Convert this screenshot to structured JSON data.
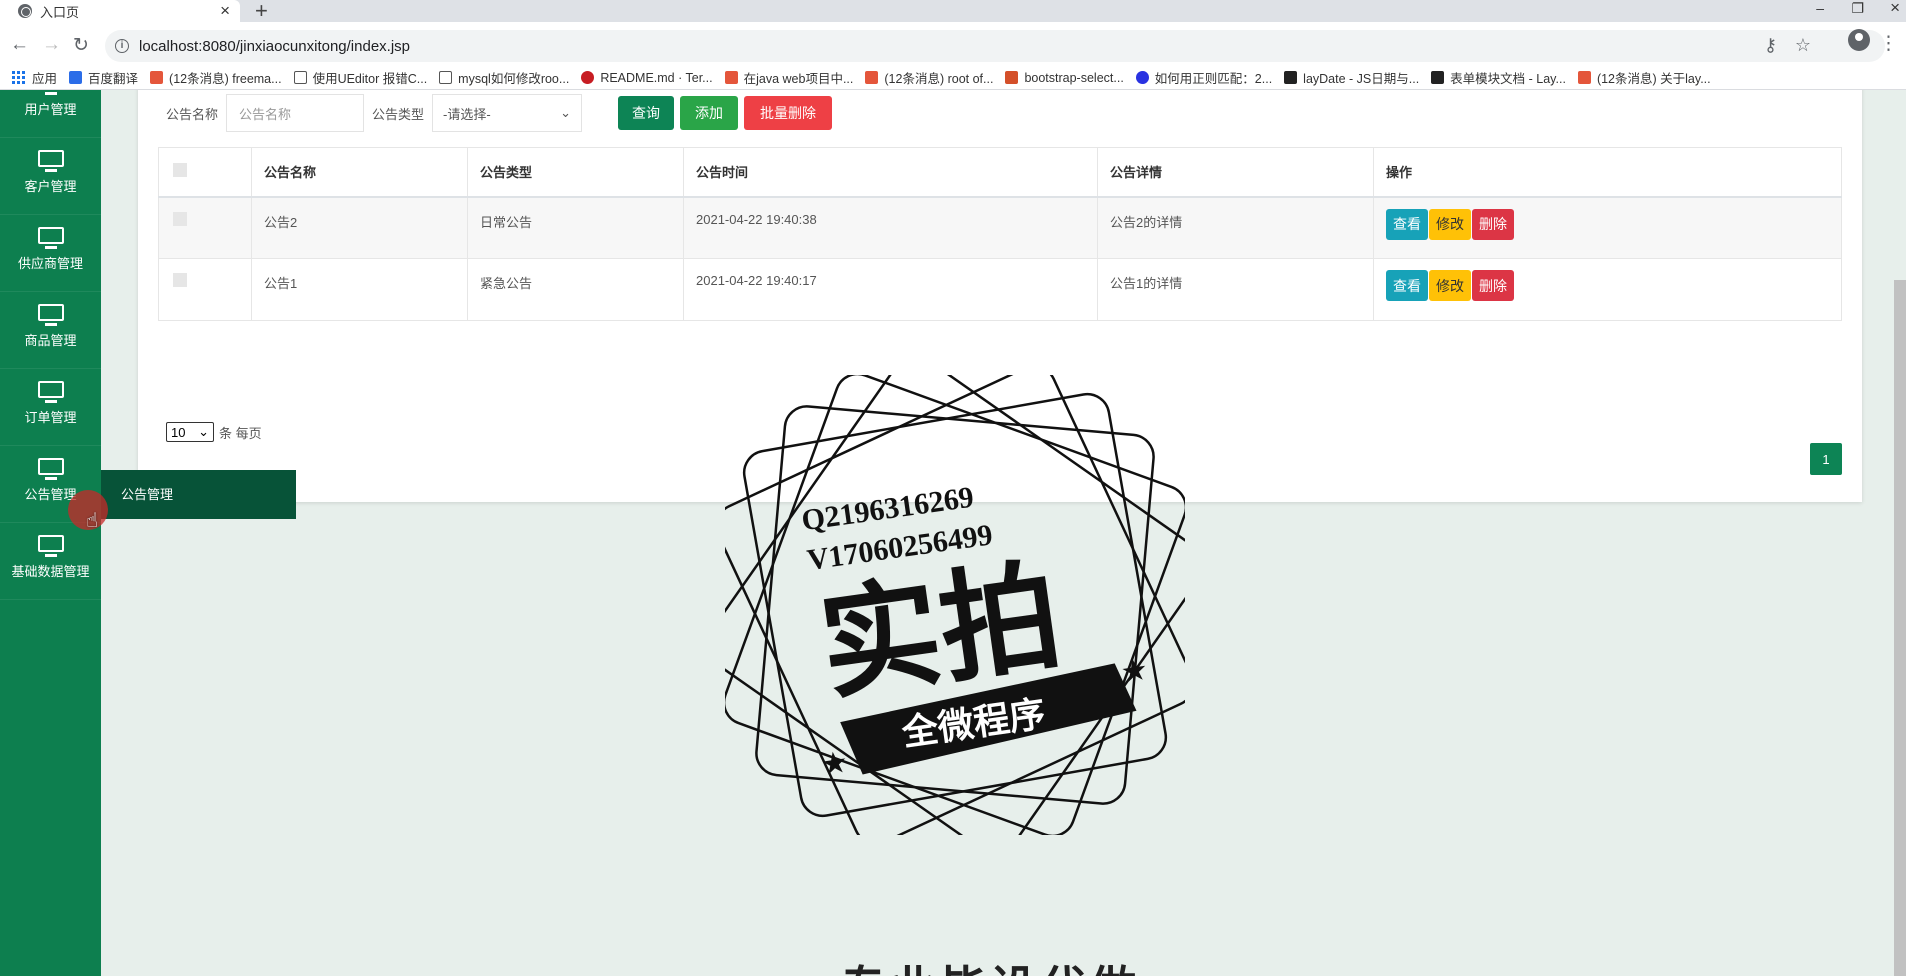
{
  "browser": {
    "tab_title": "入口页",
    "url": "localhost:8080/jinxiaocunxitong/index.jsp",
    "bookmarks": [
      {
        "label": "应用",
        "color": "#1a73e8"
      },
      {
        "label": "百度翻译",
        "color": "#2b6de8"
      },
      {
        "label": "(12条消息) freema...",
        "color": "#e4563b"
      },
      {
        "label": "使用UEditor 报错C...",
        "color": "#555555"
      },
      {
        "label": "mysql如何修改roo...",
        "color": "#555555"
      },
      {
        "label": "README.md · Ter...",
        "color": "#c71d23"
      },
      {
        "label": "在java web项目中...",
        "color": "#e4563b"
      },
      {
        "label": "(12条消息) root of...",
        "color": "#e4563b"
      },
      {
        "label": "bootstrap-select...",
        "color": "#d4502a"
      },
      {
        "label": "如何用正则匹配：2...",
        "color": "#2932e1"
      },
      {
        "label": "layDate - JS日期与...",
        "color": "#222222"
      },
      {
        "label": "表单模块文档 - Lay...",
        "color": "#222222"
      },
      {
        "label": "(12条消息) 关于lay...",
        "color": "#e4563b"
      }
    ]
  },
  "sidebar": {
    "items": [
      {
        "label": "用户管理"
      },
      {
        "label": "客户管理"
      },
      {
        "label": "供应商管理"
      },
      {
        "label": "商品管理"
      },
      {
        "label": "订单管理"
      },
      {
        "label": "公告管理"
      },
      {
        "label": "基础数据管理"
      }
    ],
    "flyout": "公告管理"
  },
  "search": {
    "name_label": "公告名称",
    "name_placeholder": "公告名称",
    "type_label": "公告类型",
    "type_selected": "-请选择-",
    "query": "查询",
    "add": "添加",
    "batch_delete": "批量删除"
  },
  "table": {
    "headers": [
      "公告名称",
      "公告类型",
      "公告时间",
      "公告详情",
      "操作"
    ],
    "rows": [
      {
        "name": "公告2",
        "type": "日常公告",
        "time": "2021-04-22 19:40:38",
        "detail": "公告2的详情"
      },
      {
        "name": "公告1",
        "type": "紧急公告",
        "time": "2021-04-22 19:40:17",
        "detail": "公告1的详情"
      }
    ],
    "actions": {
      "view": "查看",
      "edit": "修改",
      "delete": "删除"
    }
  },
  "pagination": {
    "page_size": "10",
    "page_size_suffix": "条 每页",
    "current_page": "1"
  },
  "watermark": {
    "line1": "Q2196316269",
    "line2": "V17060256499",
    "main": "实拍",
    "banner": "全微程序",
    "bottom_text": "专业毕设代做"
  },
  "colors": {
    "sidebar": "#0d7f4f",
    "primary": "#0d8455",
    "danger": "#ee4045"
  }
}
